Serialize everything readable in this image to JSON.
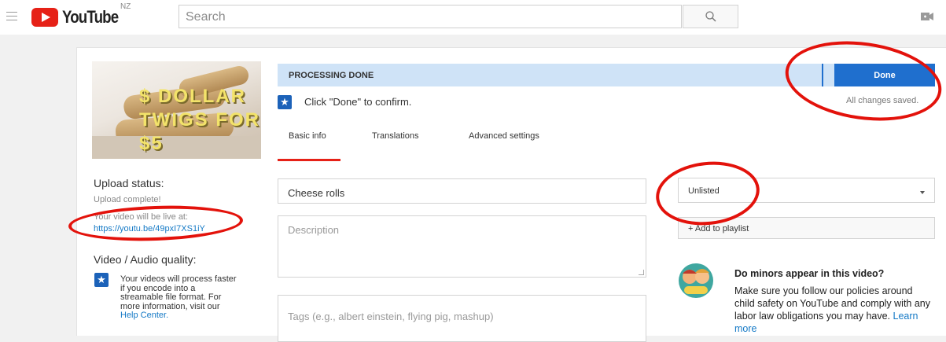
{
  "header": {
    "logo_text": "YouTube",
    "region": "NZ",
    "search_placeholder": "Search",
    "icons": [
      "menu-icon",
      "search-icon",
      "create-video-icon"
    ]
  },
  "thumbnail": {
    "caption": "$ DOLLAR TWIGS FOR $5"
  },
  "sidebar": {
    "upload_status_title": "Upload status:",
    "upload_status": "Upload complete!",
    "live_at_label": "Your video will be live at:",
    "video_url": "https://youtu.be/49pxI7XS1iY",
    "quality_title": "Video / Audio quality:",
    "quality_text": "Your videos will process faster if you encode into a streamable file format. For more information, visit our",
    "help_link": "Help Center."
  },
  "banner": {
    "status": "PROCESSING DONE",
    "done_label": "Done",
    "saved_text": "All changes saved.",
    "confirm_text": "Click \"Done\" to confirm."
  },
  "tabs": [
    {
      "label": "Basic info",
      "active": true
    },
    {
      "label": "Translations",
      "active": false
    },
    {
      "label": "Advanced settings",
      "active": false
    }
  ],
  "form": {
    "title_value": "Cheese rolls",
    "description_placeholder": "Description",
    "tags_placeholder": "Tags (e.g., albert einstein, flying pig, mashup)",
    "privacy_value": "Unlisted",
    "playlist_label": "+ Add to playlist"
  },
  "minors": {
    "title": "Do minors appear in this video?",
    "body": "Make sure you follow our policies around child safety on YouTube and comply with any labor law obligations you may have.",
    "link": "Learn more"
  },
  "colors": {
    "brand_red": "#e62117",
    "accent_blue": "#1f6fce",
    "banner_blue": "#cfe3f7",
    "annotation_red": "#e3120b"
  }
}
